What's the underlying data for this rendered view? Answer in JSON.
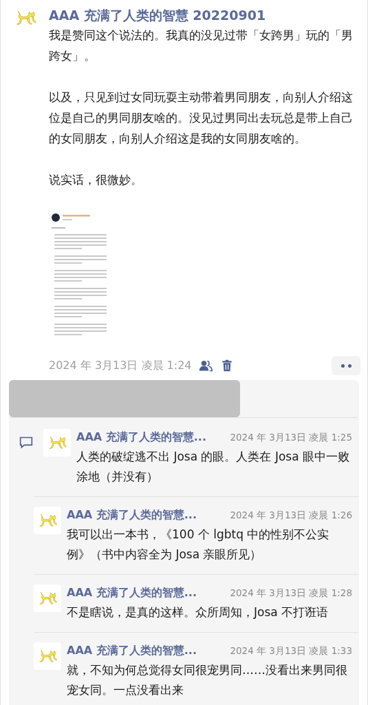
{
  "post": {
    "author": "AAA 充满了人类的智慧 20220901",
    "paragraphs": [
      "我是赞同这个说法的。我真的没见过带「女跨男」玩的「男跨女」。",
      "以及，只见到过女同玩耍主动带着男同朋友，向别人介绍这位是自己的男同朋友啥的。没见过男同出去玩总是带上自己的女同朋友，向别人介绍这是我的女同朋友啥的。",
      "说实话，很微妙。"
    ],
    "image": {
      "kind": "picture"
    },
    "timestamp": "2024 年 3月13日 凌晨 1:24"
  },
  "comments": [
    {
      "author": "AAA 充满了人类的智慧...",
      "time": "2024 年 3月13日 凌晨 1:25",
      "text": "人类的破绽逃不出 Josa 的眼。人类在 Josa 眼中一败涂地（并没有）"
    },
    {
      "author": "AAA 充满了人类的智慧...",
      "time": "2024 年 3月13日 凌晨 1:26",
      "text": "我可以出一本书，《100 个 lgbtq 中的性别不公实例》（书中内容全为 Josa 亲眼所见）"
    },
    {
      "author": "AAA 充满了人类的智慧...",
      "time": "2024 年 3月13日 凌晨 1:28",
      "text": "不是瞎说，是真的这样。众所周知，Josa 不打诳语"
    },
    {
      "author": "AAA 充满了人类的智慧...",
      "time": "2024 年 3月13日 凌晨 1:33",
      "text": "就，不知为何总觉得女同很宠男同……没看出来男同很宠女同。一点没看出来"
    }
  ]
}
